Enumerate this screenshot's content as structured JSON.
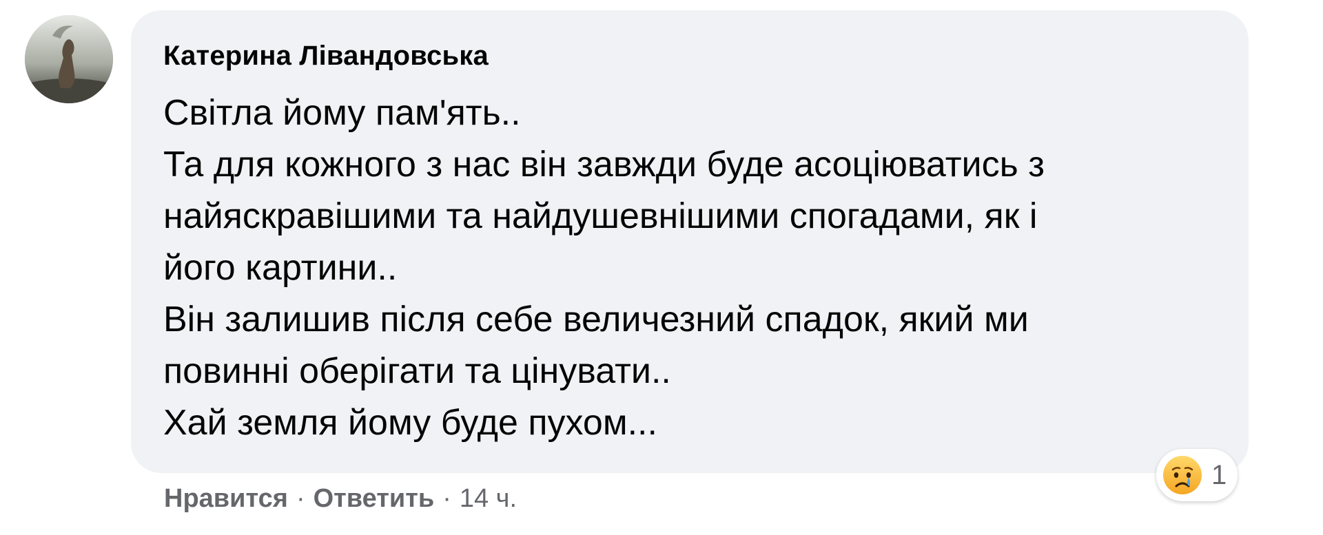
{
  "comment": {
    "author": "Катерина Лівандовська",
    "lines": [
      "Світла йому пам'ять..",
      "Та для кожного з нас він завжди буде асоціюватись з",
      "найяскравішими та найдушевнішими спогадами, як і",
      "його картини..",
      "Він залишив після себе величезний спадок, який ми",
      "повинні оберігати та цінувати..",
      "Хай земля йому буде пухом..."
    ],
    "reaction": {
      "icon": "sad-reaction-icon",
      "count": "1"
    },
    "actions": {
      "like_label": "Нравится",
      "separator": "·",
      "reply_label": "Ответить",
      "time": "14 ч."
    }
  },
  "colors": {
    "bubble_bg": "#f0f2f5",
    "secondary_text": "#65676b",
    "primary_text": "#050505"
  }
}
